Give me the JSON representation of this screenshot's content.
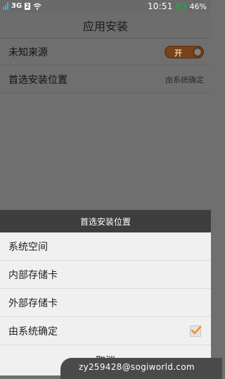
{
  "status_bar": {
    "network": "3G",
    "sim_slot": "2",
    "time": "10:51",
    "battery": "46%"
  },
  "screen": {
    "title": "应用安装"
  },
  "settings": {
    "unknown_sources": {
      "label": "未知来源",
      "toggle_text": "开",
      "enabled": true
    },
    "install_location": {
      "label": "首选安装位置",
      "value": "由系统确定"
    }
  },
  "dialog": {
    "title": "首选安装位置",
    "options": [
      {
        "label": "系统空间",
        "selected": false
      },
      {
        "label": "内部存储卡",
        "selected": false
      },
      {
        "label": "外部存储卡",
        "selected": false
      },
      {
        "label": "由系统确定",
        "selected": true
      }
    ],
    "cancel_label": "取消"
  },
  "watermark": "zy259428@sogiworld.com",
  "colors": {
    "accent_orange": "#f08a24",
    "dialog_header": "#3e3e3e",
    "signal_blue": "#36b4e8",
    "battery_green": "#2e9a45"
  }
}
